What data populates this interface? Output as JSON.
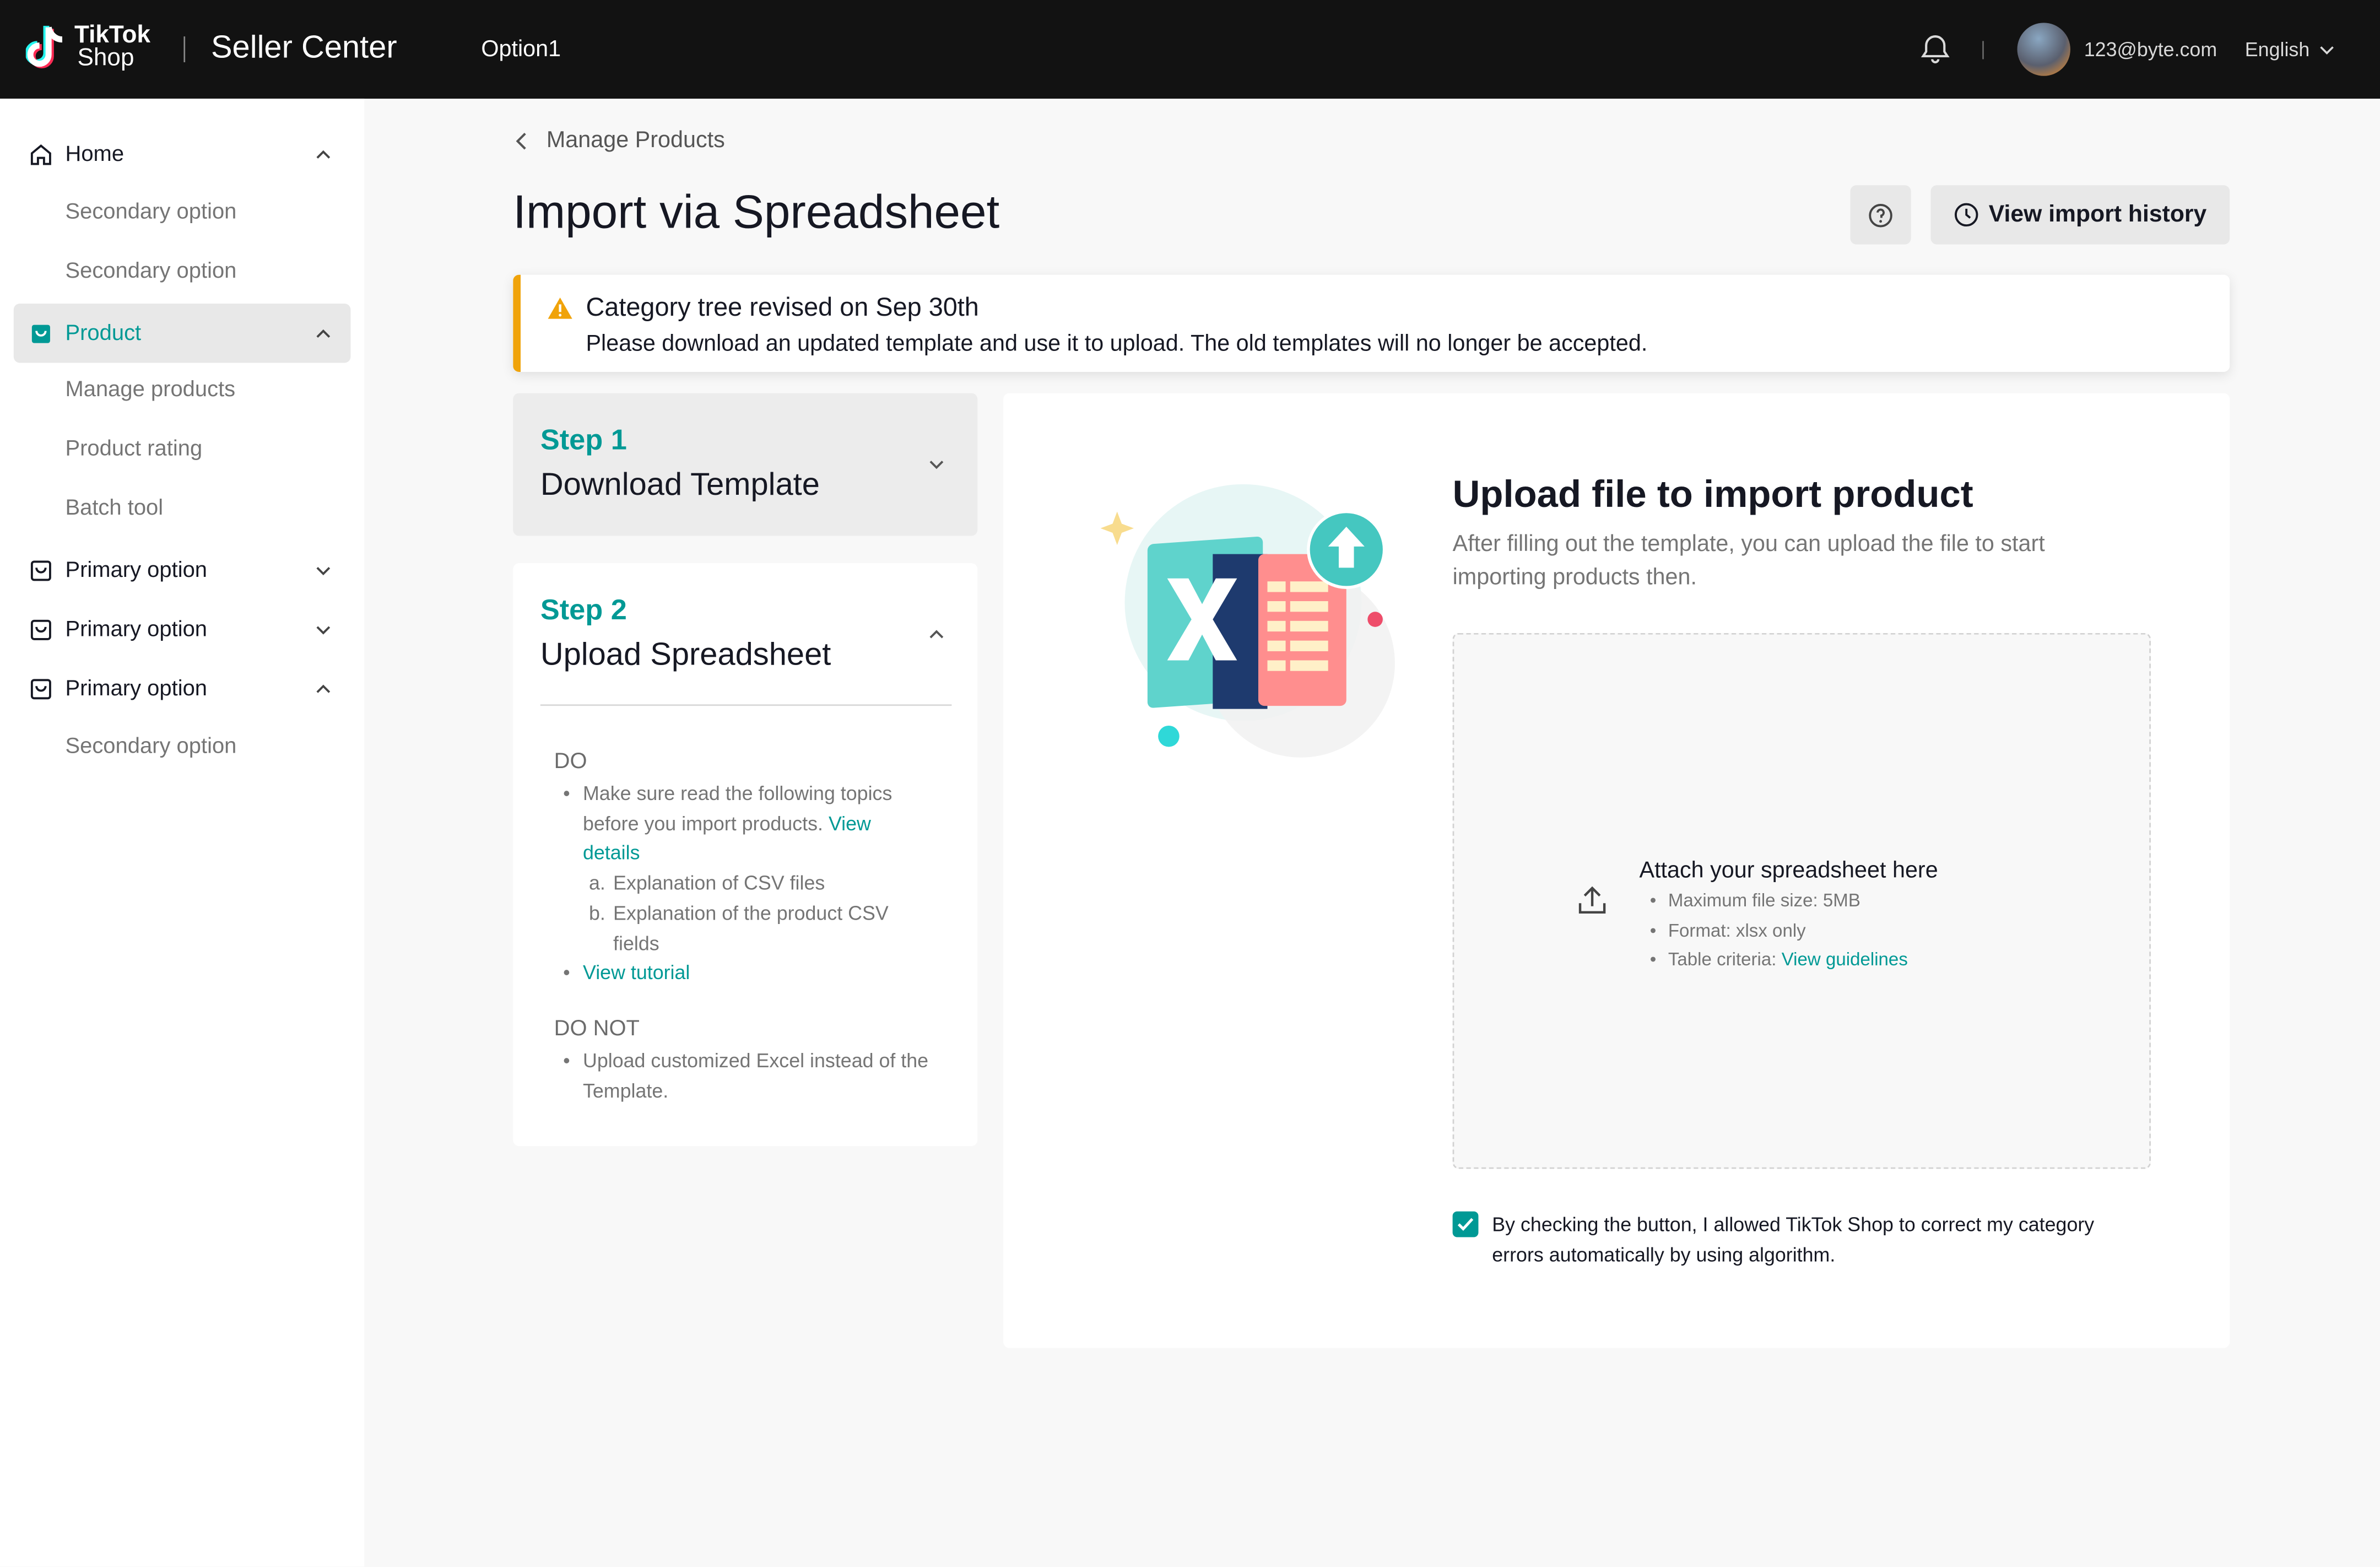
{
  "header": {
    "logo_line1": "TikTok",
    "logo_line2": "Shop",
    "app_title": "Seller Center",
    "option": "Option1",
    "user_email": "123@byte.com",
    "language": "English"
  },
  "sidebar": {
    "home": "Home",
    "home_sub1": "Secondary option",
    "home_sub2": "Secondary option",
    "product": "Product",
    "product_sub1": "Manage products",
    "product_sub2": "Product rating",
    "product_sub3": "Batch tool",
    "primary1": "Primary option",
    "primary2": "Primary option",
    "primary3": "Primary option",
    "primary3_sub1": "Secondary option"
  },
  "breadcrumb": {
    "back_label": "Manage Products"
  },
  "page": {
    "title": "Import via Spreadsheet",
    "history_button": "View import history"
  },
  "alert": {
    "title": "Category tree revised on Sep 30th",
    "message": "Please download an updated template and use it to upload. The old templates will no longer be accepted."
  },
  "steps": {
    "step1_no": "Step 1",
    "step1_title": "Download Template",
    "step2_no": "Step 2",
    "step2_title": "Upload Spreadsheet",
    "do_heading": "DO",
    "do_rule1": "Make sure read the following topics before you import products.",
    "do_rule1_link": "View details",
    "do_sub_a": "Explanation of CSV files",
    "do_sub_b": "Explanation of the product CSV fields",
    "do_rule2_link": "View tutorial",
    "donot_heading": "DO NOT",
    "donot_rule1": "Upload customized Excel instead of the Template."
  },
  "upload": {
    "title": "Upload file to import product",
    "description": "After filling out the template, you can upload the file to start importing products then.",
    "dropzone_title": "Attach your spreadsheet here",
    "req_size": "Maximum file size: 5MB",
    "req_format": "Format: xlsx only",
    "req_criteria": "Table criteria:",
    "req_criteria_link": "View guidelines",
    "consent_checked": true,
    "consent_text": "By checking the button, I allowed TikTok Shop to correct my category errors automatically by using algorithm."
  },
  "colors": {
    "brand_teal": "#009995",
    "warning": "#f0a30a",
    "topbar": "#121212"
  }
}
